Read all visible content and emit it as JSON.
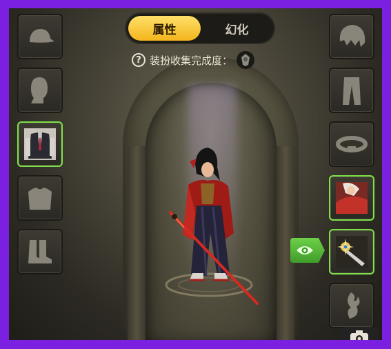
{
  "tabs": {
    "attributes": "属性",
    "transform": "幻化"
  },
  "collection": {
    "label": "装扮收集完成度：",
    "help": "?"
  },
  "left_slots": [
    "hat-slot",
    "face-slot",
    "coat-slot",
    "neck-slot",
    "shoes-slot"
  ],
  "right_slots": [
    "hair-slot",
    "pants-slot",
    "belt-slot",
    "skin-slot",
    "weapon-slot",
    "aura-slot"
  ],
  "colors": {
    "accent": "#f3b51c",
    "selected_border": "#7fe04a",
    "eye_button": "#5bbf3c"
  }
}
